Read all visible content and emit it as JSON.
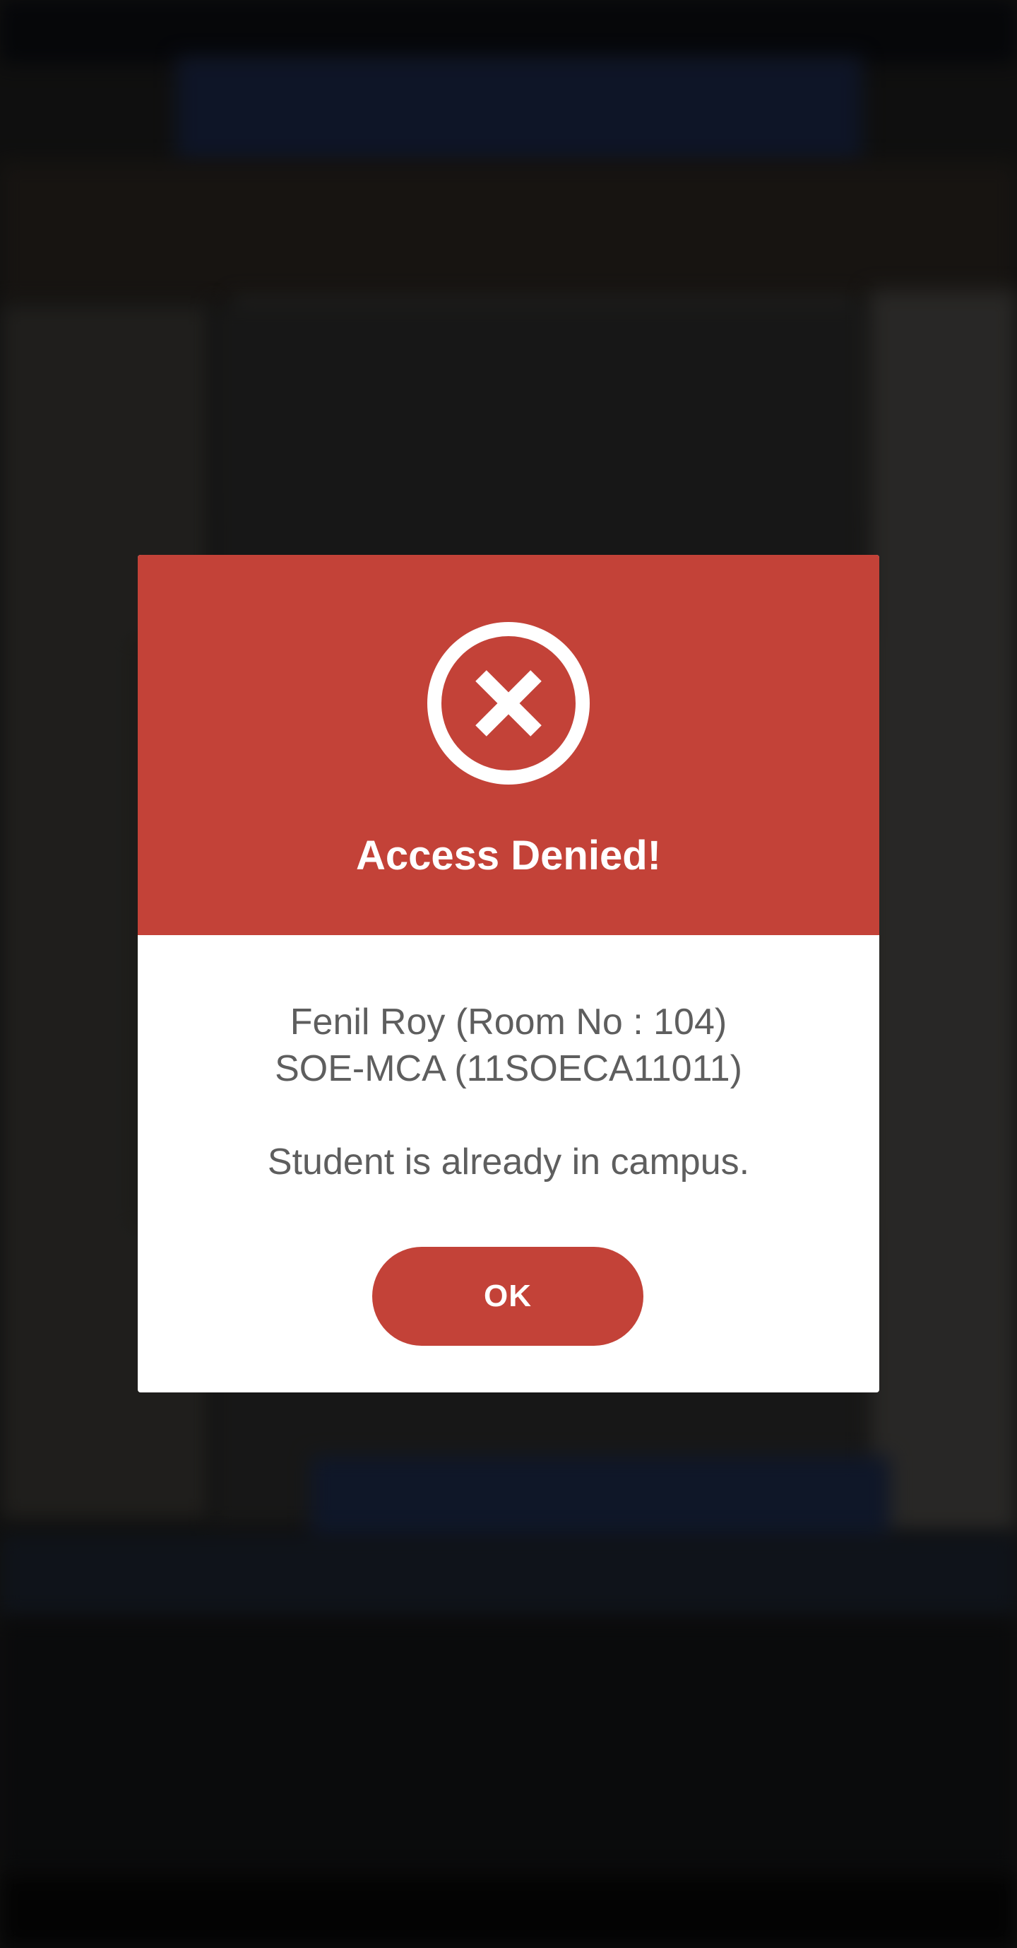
{
  "dialog": {
    "icon": "close-circle-icon",
    "title": "Access Denied!",
    "student_line": "Fenil Roy (Room No : 104)",
    "program_line": "SOE-MCA (11SOECA11011)",
    "message": "Student is already in campus.",
    "ok_label": "OK"
  },
  "colors": {
    "accent": "#c34238",
    "dialog_background": "#ffffff",
    "body_text": "#5e5e5e"
  }
}
